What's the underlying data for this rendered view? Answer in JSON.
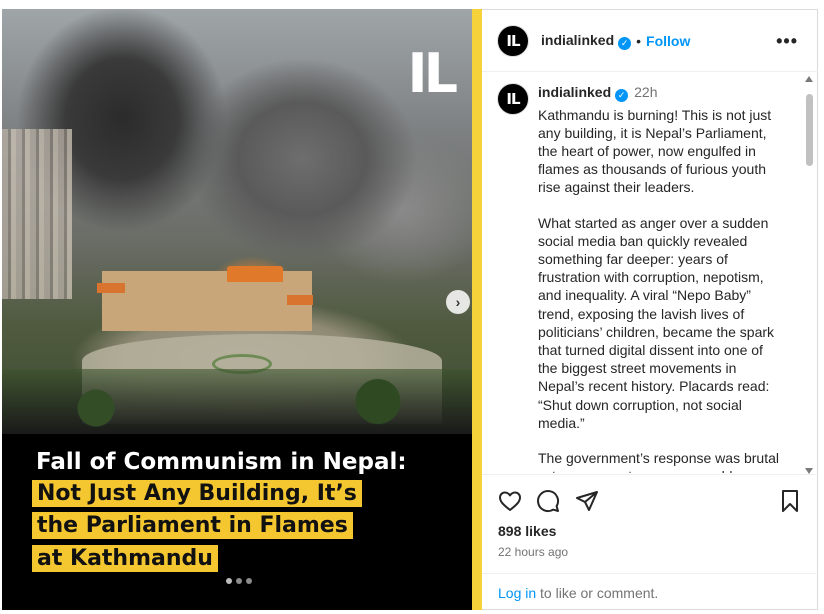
{
  "media": {
    "watermark": "IL",
    "headline_line1": "Fall of Communism in Nepal:",
    "highlight_lines": [
      "Not Just Any Building, It’s",
      "the Parliament in Flames",
      "at Kathmandu"
    ],
    "carousel_dots": 3,
    "next_glyph": "›"
  },
  "header": {
    "avatar_text": "IL",
    "username": "indialinked",
    "separator": "•",
    "follow_label": "Follow",
    "more_label": "•••"
  },
  "caption": {
    "avatar_text": "IL",
    "username": "indialinked",
    "time": "22h",
    "paragraphs": [
      "Kathmandu is burning! This is not just any building, it is Nepal’s Parliament, the heart of power, now engulfed in flames as thousands of furious youth rise against their leaders.",
      "What started as anger over a sudden social media ban quickly revealed something far deeper: years of frustration with corruption, nepotism, and inequality. A viral “Nepo Baby” trend, exposing the lavish lives of politicians’ children, became the spark that turned digital dissent into one of the biggest street movements in Nepal’s recent history. Placards read: “Shut down corruption, not social media.”",
      "The government’s response was brutal —tear gas, water cannons, rubber"
    ]
  },
  "actions": {
    "likes": "898 likes",
    "timestamp": "22 hours ago",
    "login_link": "Log in",
    "login_suffix": " to like or comment."
  },
  "colors": {
    "accent": "#0095f6",
    "highlight": "#f4c730",
    "divider": "#f6d23a"
  }
}
